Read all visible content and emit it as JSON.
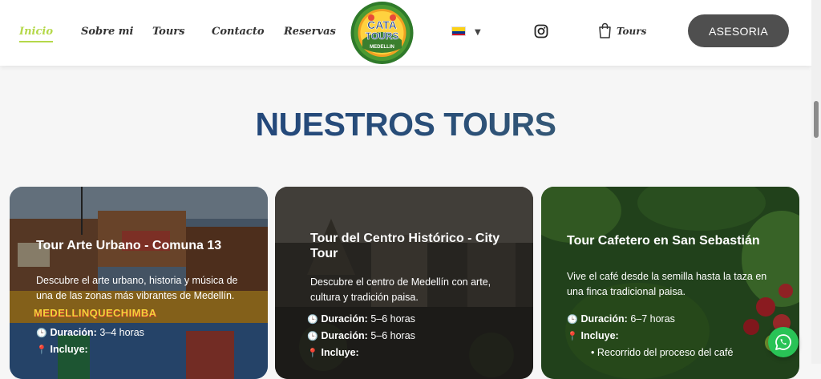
{
  "nav": {
    "items": [
      {
        "label": "Inicio"
      },
      {
        "label": "Sobre mi"
      },
      {
        "label": "Tours"
      },
      {
        "label": "Contacto"
      },
      {
        "label": "Reservas"
      }
    ],
    "logo": {
      "line1": "CATA",
      "line2": "TOURS",
      "line3": "MEDELLIN"
    },
    "language_flag": "colombia-flag",
    "instagram_icon": "instagram-icon",
    "cart_label": "Tours",
    "cta_label": "ASESORIA"
  },
  "section": {
    "title": "NUESTROS TOURS"
  },
  "cards": [
    {
      "title": "Tour Arte Urbano - Comuna 13",
      "description": "Descubre el arte urbano, historia y música de una de las zonas más vibrantes de Medellín.",
      "details": [
        {
          "icon": "clock-icon",
          "label": "Duración:",
          "value": "3–4 horas"
        },
        {
          "icon": "pin-icon",
          "label": "Incluye:",
          "value": ""
        }
      ],
      "mural_text": "MEDELLINQUECHIMBA"
    },
    {
      "title": "Tour del Centro Histórico - City Tour",
      "description": "Descubre el centro de Medellín con arte, cultura y tradición paisa.",
      "details": [
        {
          "icon": "clock-icon",
          "label": "Duración:",
          "value": "5–6 horas"
        },
        {
          "icon": "clock-icon",
          "label": "Duración:",
          "value": "5–6 horas"
        },
        {
          "icon": "pin-icon",
          "label": "Incluye:",
          "value": ""
        }
      ]
    },
    {
      "title": "Tour Cafetero en San Sebastián",
      "description": "Vive el café desde la semilla hasta la taza en una finca tradicional paisa.",
      "details": [
        {
          "icon": "clock-icon",
          "label": "Duración:",
          "value": "6–7 horas"
        },
        {
          "icon": "pin-icon",
          "label": "Incluye:",
          "value": ""
        }
      ],
      "bullets": [
        "Recorrido del proceso del café"
      ]
    }
  ],
  "whatsapp_icon": "whatsapp-icon",
  "colors": {
    "accent": "#b5d84a",
    "button": "#4f4f4f",
    "title_start": "#1a3e7e",
    "whatsapp": "#29c356"
  }
}
